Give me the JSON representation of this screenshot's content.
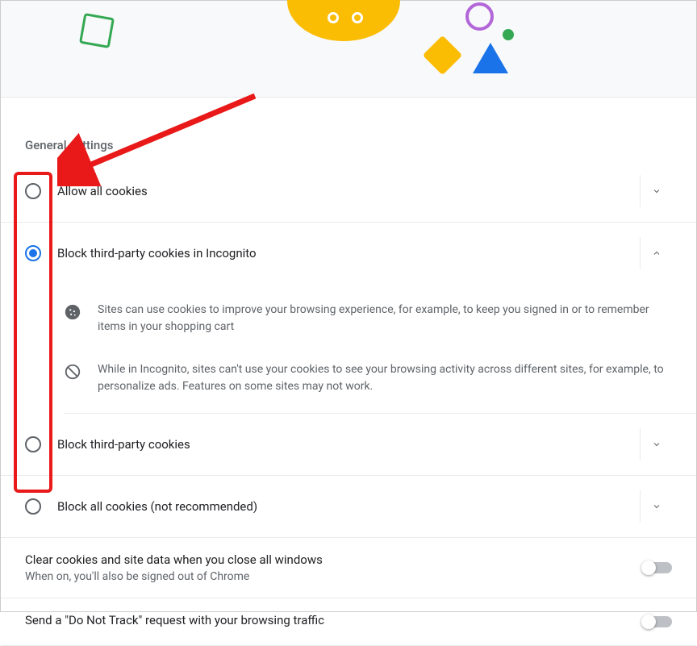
{
  "sectionTitle": "General settings",
  "options": [
    {
      "label": "Allow all cookies",
      "selected": false,
      "expanded": false
    },
    {
      "label": "Block third-party cookies in Incognito",
      "selected": true,
      "expanded": true
    },
    {
      "label": "Block third-party cookies",
      "selected": false,
      "expanded": false
    },
    {
      "label": "Block all cookies (not recommended)",
      "selected": false,
      "expanded": false
    }
  ],
  "details": [
    {
      "icon": "cookie",
      "text": "Sites can use cookies to improve your browsing experience, for example, to keep you signed in or to remember items in your shopping cart"
    },
    {
      "icon": "block",
      "text": "While in Incognito, sites can't use your cookies to see your browsing activity across different sites, for example, to personalize ads. Features on some sites may not work."
    }
  ],
  "toggles": [
    {
      "title": "Clear cookies and site data when you close all windows",
      "sub": "When on, you'll also be signed out of Chrome",
      "on": false
    },
    {
      "title": "Send a \"Do Not Track\" request with your browsing traffic",
      "sub": "",
      "on": false
    }
  ]
}
